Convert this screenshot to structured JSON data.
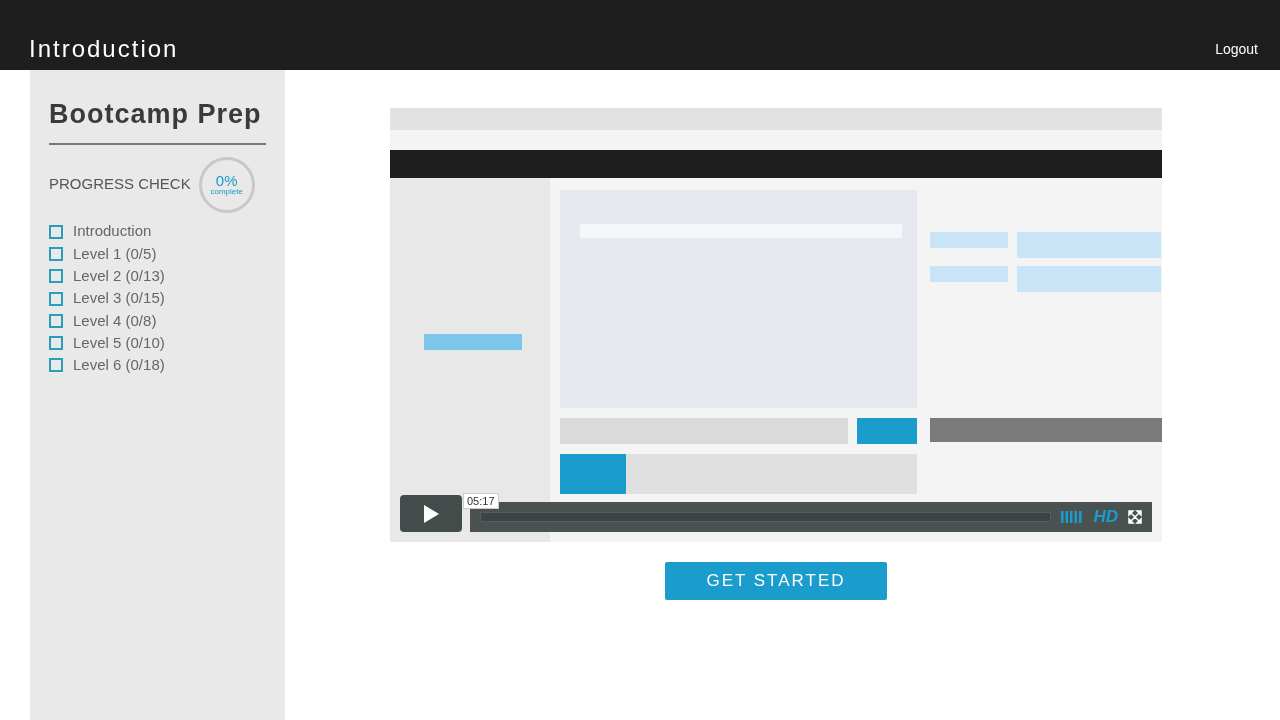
{
  "header": {
    "title": "Introduction",
    "logout": "Logout"
  },
  "sidebar": {
    "title": "Bootcamp Prep",
    "progress_label": "PROGRESS CHECK",
    "progress_percent": "0%",
    "progress_caption": "complete",
    "items": [
      {
        "label": "Introduction",
        "checked": false
      },
      {
        "label": "Level 1 (0/5)",
        "checked": false
      },
      {
        "label": "Level 2 (0/13)",
        "checked": false
      },
      {
        "label": "Level 3 (0/15)",
        "checked": false
      },
      {
        "label": "Level 4 (0/8)",
        "checked": false
      },
      {
        "label": "Level 5 (0/10)",
        "checked": false
      },
      {
        "label": "Level 6 (0/18)",
        "checked": false
      }
    ]
  },
  "video": {
    "kind": "picture",
    "time_tooltip": "05:17",
    "quality": "HD"
  },
  "cta": {
    "label": "GET STARTED"
  }
}
